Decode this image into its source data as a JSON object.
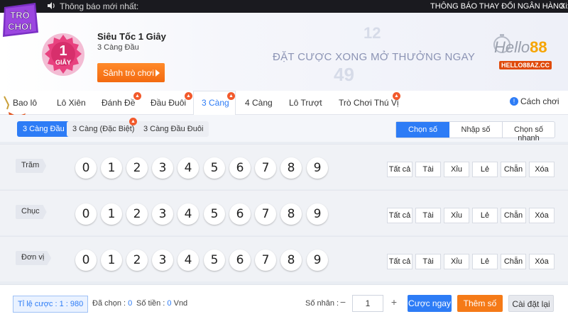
{
  "topbar": {
    "notice": "Thông báo mới nhất:",
    "marquee": "THÔNG BÁO THAY ĐỔI NGÂN HÀNG :",
    "trailing": "Xi"
  },
  "app_logo": {
    "line1": "TRÒ",
    "line2": "CHƠI"
  },
  "header": {
    "badge": {
      "number": "1",
      "unit": "GIÂY"
    },
    "title": "Siêu Tốc 1 Giây",
    "subtitle": "3 Càng Đầu",
    "lobby_button": "Sảnh trò chơi",
    "slogan": "ĐẶT CƯỢC XONG MỞ THƯỞNG NGAY",
    "brand": {
      "hello": "Hello",
      "num": "88",
      "domain": "HELLO88AZ.CC"
    },
    "background_numbers": [
      "12",
      "49"
    ]
  },
  "tabs": [
    {
      "label": "Bao lô",
      "hot": false
    },
    {
      "label": "Lô Xiên",
      "hot": false
    },
    {
      "label": "Đánh Đề",
      "hot": true
    },
    {
      "label": "Đầu Đuôi",
      "hot": true
    },
    {
      "label": "3 Càng",
      "hot": true,
      "active": true
    },
    {
      "label": "4 Càng",
      "hot": false
    },
    {
      "label": "Lô Trượt",
      "hot": false
    },
    {
      "label": "Trò Chơi Thú Vị",
      "hot": true
    }
  ],
  "help_label": "Cách chơi",
  "subtabs": [
    {
      "label": "3 Càng Đầu",
      "active": true
    },
    {
      "label": "3 Càng (Đặc Biệt)",
      "hot": true
    },
    {
      "label": "3 Càng Đầu Đuôi"
    }
  ],
  "input_modes": [
    {
      "label": "Chọn số",
      "active": true
    },
    {
      "label": "Nhập số"
    },
    {
      "label": "Chọn số nhanh"
    }
  ],
  "rows": [
    {
      "label": "Trăm"
    },
    {
      "label": "Chục"
    },
    {
      "label": "Đơn vị"
    }
  ],
  "digits": [
    "0",
    "1",
    "2",
    "3",
    "4",
    "5",
    "6",
    "7",
    "8",
    "9"
  ],
  "quick_buttons": [
    "Tất cả",
    "Tài",
    "Xỉu",
    "Lẻ",
    "Chẵn",
    "Xóa"
  ],
  "footer": {
    "odds_label": "Tỉ lệ cược : ",
    "odds_value": "1 : 980",
    "selected_label": "Đã chọn : ",
    "selected_value": "0",
    "amount_label": "Số tiền : ",
    "amount_value": "0",
    "amount_unit": " Vnd",
    "multiplier_label": "Số nhân :",
    "multiplier_value": "1",
    "bet_button": "Cược ngay",
    "add_button": "Thêm số",
    "reset_button": "Cài đặt lại"
  },
  "colors": {
    "accent_blue": "#2d7cf6",
    "orange": "#f57a17",
    "hot_red": "#f25a2c",
    "badge_pink": "#e8417f"
  }
}
